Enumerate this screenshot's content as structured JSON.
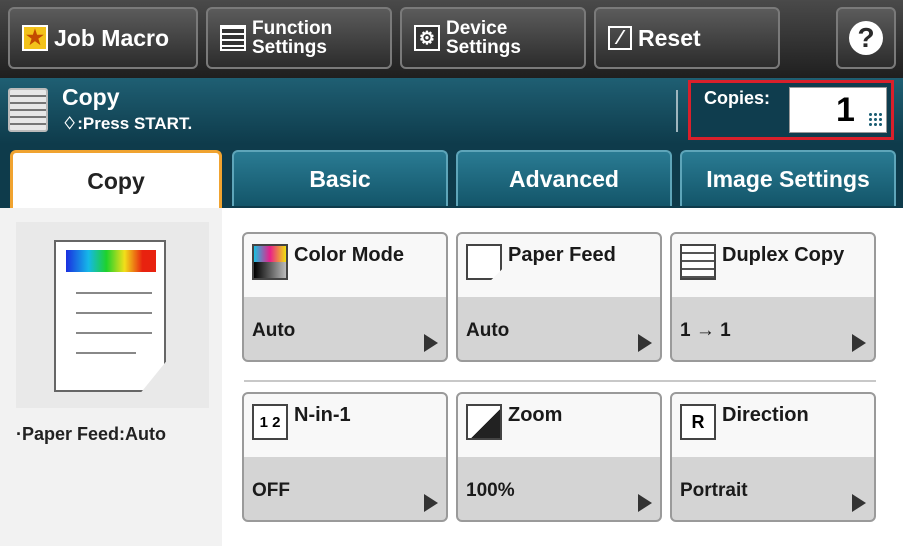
{
  "toolbar": {
    "job_macro": "Job Macro",
    "function_settings": [
      "Function",
      "Settings"
    ],
    "device_settings": [
      "Device",
      "Settings"
    ],
    "reset": "Reset",
    "help": "?"
  },
  "status": {
    "mode": "Copy",
    "prompt": "♢:Press START.",
    "copies_label": "Copies:",
    "copies_value": "1"
  },
  "tabs": [
    {
      "label": "Copy",
      "active": true
    },
    {
      "label": "Basic",
      "active": false
    },
    {
      "label": "Advanced",
      "active": false
    },
    {
      "label": "Image Settings",
      "active": false
    }
  ],
  "preview": {
    "info": "·Paper Feed:Auto"
  },
  "functions": [
    {
      "label": "Color Mode",
      "value": "Auto",
      "icon": "color-mode-icon"
    },
    {
      "label": "Paper Feed",
      "value": "Auto",
      "icon": "paper-feed-icon"
    },
    {
      "label": "Duplex Copy",
      "value": "1 → 1",
      "icon": "duplex-copy-icon"
    },
    {
      "label": "N-in-1",
      "value": "OFF",
      "icon": "n-in-1-icon"
    },
    {
      "label": "Zoom",
      "value": "100%",
      "icon": "zoom-icon"
    },
    {
      "label": "Direction",
      "value": "Portrait",
      "icon": "direction-icon"
    }
  ],
  "colors": {
    "header_teal": "#0e3b4b",
    "tab_teal": "#1e6c83",
    "active_tab_border": "#f0a330",
    "copies_highlight": "#d9202b"
  }
}
